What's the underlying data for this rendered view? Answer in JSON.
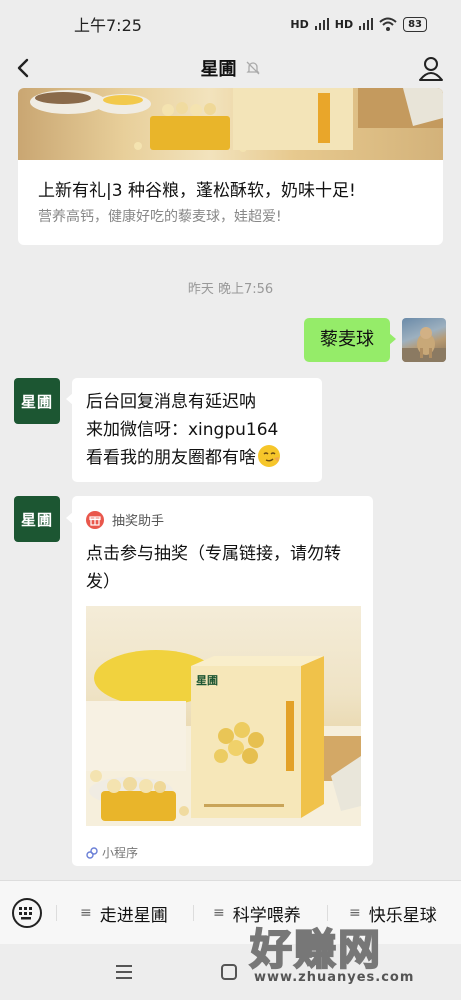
{
  "status_bar": {
    "time": "上午7:25",
    "signal_1": "HD",
    "signal_2": "HD",
    "battery": "83"
  },
  "header": {
    "title": "星圃"
  },
  "top_card": {
    "title": "上新有礼|3 种谷粮，蓬松酥软，奶味十足!",
    "subtitle": "营养高钙，健康好吃的藜麦球，娃超爱!"
  },
  "timestamp": "昨天 晚上7:56",
  "my_message": {
    "text": "藜麦球"
  },
  "bot_logo": "星圃",
  "bot_message": {
    "lines": [
      "后台回复消息有延迟呐",
      "来加微信呀：xingpu164",
      "看看我的朋友圈都有啥"
    ]
  },
  "mini_program": {
    "source": "抽奖助手",
    "description": "点击参与抽奖（专属链接，请勿转发）",
    "footer": "小程序",
    "product_brand": "星圃"
  },
  "bottom_menu": {
    "items": [
      {
        "label": "走进星圃"
      },
      {
        "label": "科学喂养"
      },
      {
        "label": "快乐星球"
      }
    ]
  },
  "watermark": {
    "text": "好赚网",
    "url": "www.zhuanyes.com"
  },
  "colors": {
    "brand_green": "#1c5632",
    "my_bubble": "#95ec69",
    "background": "#ededed"
  }
}
